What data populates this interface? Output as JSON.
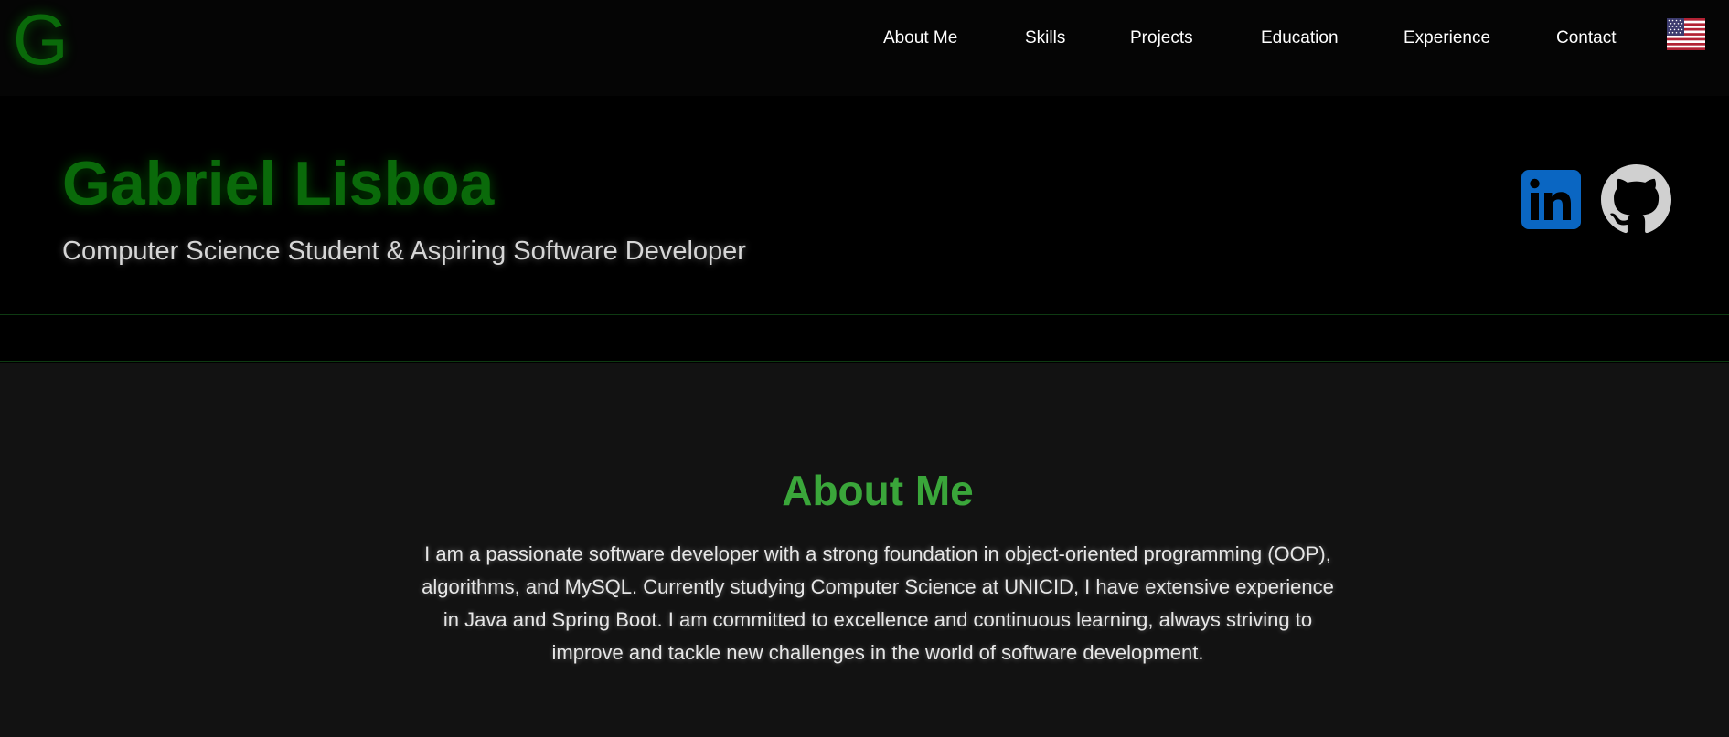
{
  "brand": {
    "logo_letter": "G",
    "logo_color": "#0a6a0a"
  },
  "nav": {
    "items": [
      {
        "label": "About Me"
      },
      {
        "label": "Skills"
      },
      {
        "label": "Projects"
      },
      {
        "label": "Education"
      },
      {
        "label": "Experience"
      },
      {
        "label": "Contact"
      }
    ],
    "language_icon": "us-flag-icon"
  },
  "hero": {
    "name": "Gabriel Lisboa",
    "subtitle": "Computer Science Student & Aspiring Software Developer",
    "social": [
      {
        "icon": "linkedin-icon",
        "color": "#0a66c2"
      },
      {
        "icon": "github-icon",
        "color": "#d0d0d0"
      }
    ]
  },
  "about": {
    "title": "About Me",
    "text": "I am a passionate software developer with a strong foundation in object-oriented programming (OOP), algorithms, and MySQL. Currently studying Computer Science at UNICID, I have extensive experience in Java and Spring Boot. I am committed to excellence and continuous learning, always striving to improve and tackle new challenges in the world of software development."
  },
  "colors": {
    "accent_green": "#3aa63a",
    "dark_green": "#0a6a0a",
    "background": "#000000",
    "section_background": "#121212"
  }
}
